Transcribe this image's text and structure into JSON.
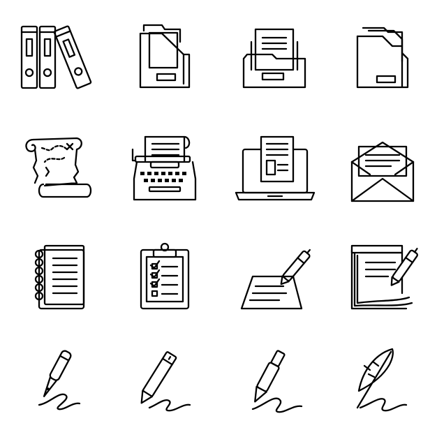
{
  "colors": {
    "stroke": "#000000",
    "background": "#ffffff"
  },
  "icons": [
    {
      "name": "binders-icon"
    },
    {
      "name": "magazine-file-holder-icon"
    },
    {
      "name": "open-folder-documents-icon"
    },
    {
      "name": "document-folder-icon"
    },
    {
      "name": "treasure-map-scroll-icon"
    },
    {
      "name": "typewriter-icon"
    },
    {
      "name": "laptop-document-icon"
    },
    {
      "name": "envelope-letter-icon"
    },
    {
      "name": "spiral-notebook-icon"
    },
    {
      "name": "clipboard-checklist-icon"
    },
    {
      "name": "signing-paper-pen-icon"
    },
    {
      "name": "notepad-pen-icon"
    },
    {
      "name": "fountain-pen-signature-icon"
    },
    {
      "name": "pencil-signature-icon"
    },
    {
      "name": "ballpoint-pen-signature-icon"
    },
    {
      "name": "quill-signature-icon"
    }
  ]
}
